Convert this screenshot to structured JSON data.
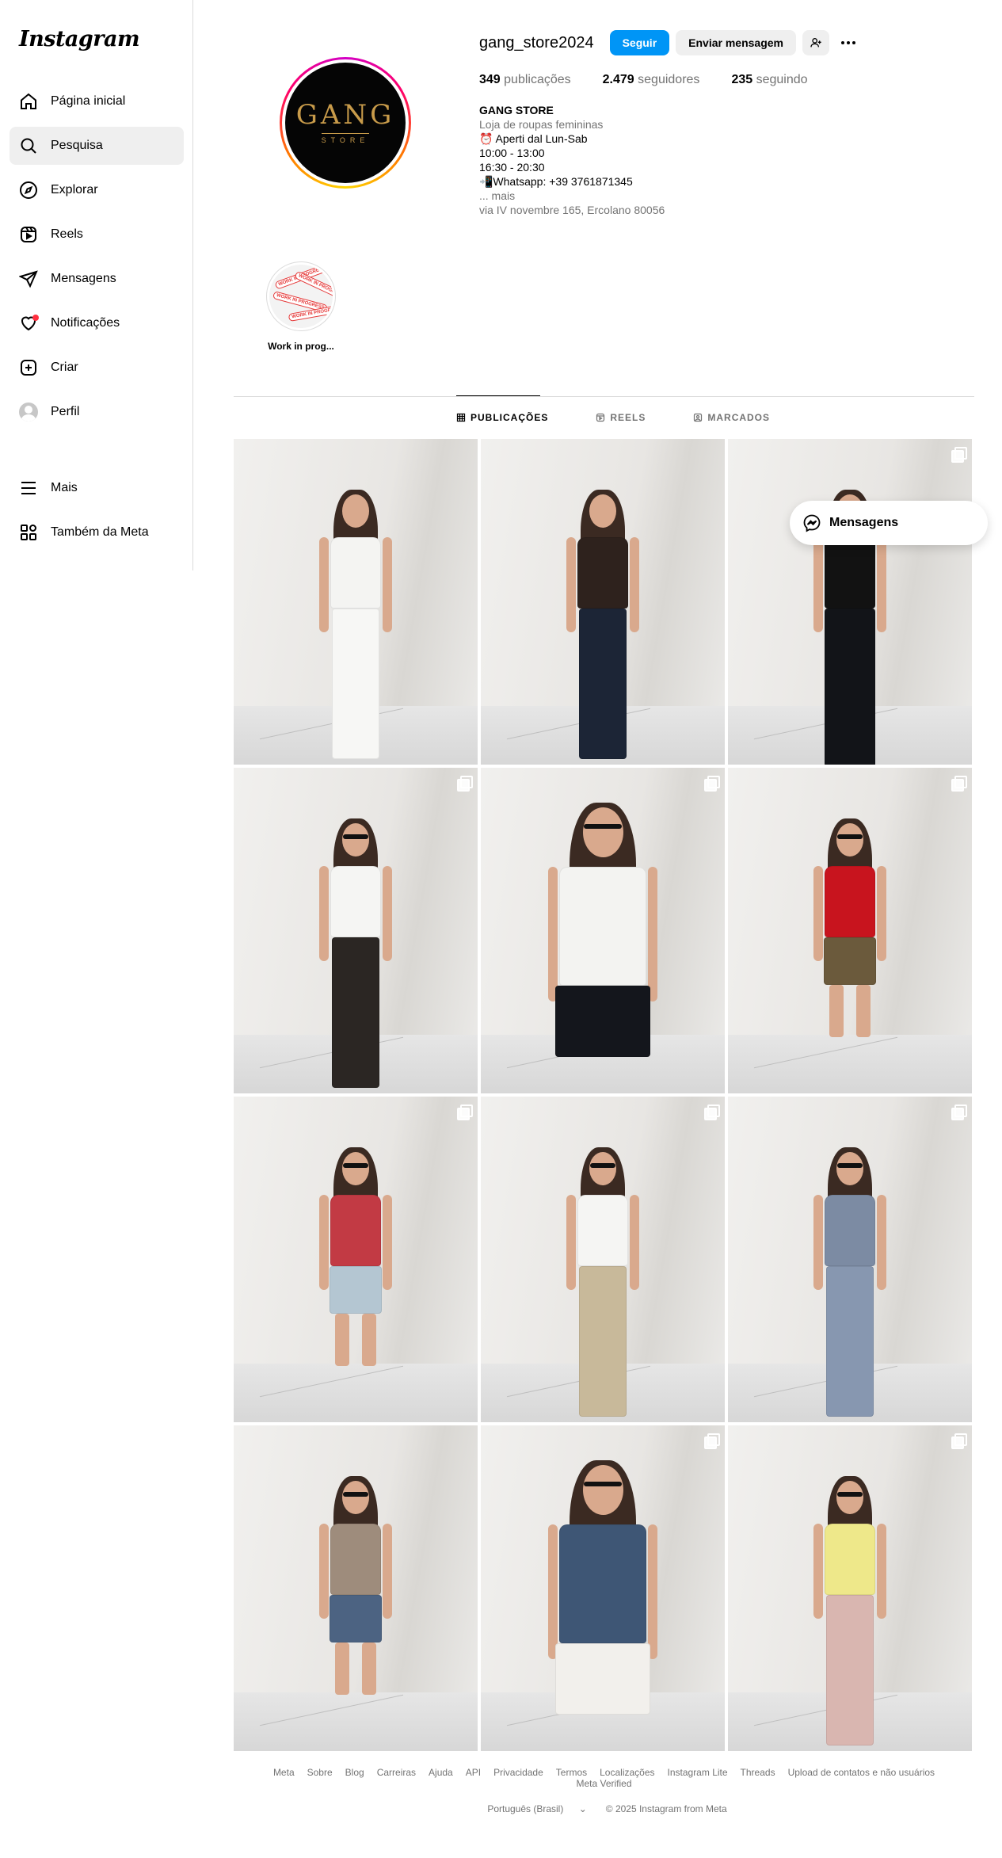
{
  "app": {
    "logo": "Instagram"
  },
  "sidebar": {
    "items": [
      {
        "label": "Página inicial",
        "icon": "home-icon"
      },
      {
        "label": "Pesquisa",
        "icon": "search-icon",
        "active": true
      },
      {
        "label": "Explorar",
        "icon": "compass-icon"
      },
      {
        "label": "Reels",
        "icon": "reels-icon"
      },
      {
        "label": "Mensagens",
        "icon": "paper-plane-icon"
      },
      {
        "label": "Notificações",
        "icon": "heart-icon",
        "has_dot": true
      },
      {
        "label": "Criar",
        "icon": "plus-square-icon"
      },
      {
        "label": "Perfil",
        "icon": "avatar"
      }
    ],
    "bottom": [
      {
        "label": "Mais",
        "icon": "menu-icon"
      },
      {
        "label": "Também da Meta",
        "icon": "grid-icon"
      }
    ]
  },
  "profile": {
    "username": "gang_store2024",
    "follow_label": "Seguir",
    "message_label": "Enviar mensagem",
    "logo_main": "GANG",
    "logo_sub": "STORE",
    "stats": {
      "posts_count": "349",
      "posts_label": "publicações",
      "followers_count": "2.479",
      "followers_label": "seguidores",
      "following_count": "235",
      "following_label": "seguindo"
    },
    "bio": {
      "name": "GANG STORE",
      "category": "Loja de roupas femininas",
      "line1": "⏰ Aperti dal Lun-Sab",
      "line2": "10:00 - 13:00",
      "line3": "16:30 - 20:30",
      "line4": "📲Whatsapp: +39 3761871345",
      "more": "... mais",
      "address": "via IV novembre 165, Ercolano 80056"
    }
  },
  "highlights": [
    {
      "label": "Work in prog...",
      "sticker": "WORK IN PROGRESS"
    }
  ],
  "tabs": [
    {
      "label": "PUBLICAÇÕES",
      "icon": "grid-icon",
      "active": true
    },
    {
      "label": "REELS",
      "icon": "reels-icon"
    },
    {
      "label": "MARCADOS",
      "icon": "tag-icon"
    }
  ],
  "posts": [
    {
      "multi": false,
      "top": "#f4f4f2",
      "bottom": "#f7f7f5",
      "shades": false,
      "pose": "standing"
    },
    {
      "multi": false,
      "top": "#2e221d",
      "bottom": "#1c2536",
      "shades": false,
      "pose": "standing"
    },
    {
      "multi": true,
      "top": "#121212",
      "bottom": "#121418",
      "shades": false,
      "pose": "long-skirt"
    },
    {
      "multi": true,
      "top": "#f5f5f3",
      "bottom": "#2b2623",
      "shades": true,
      "pose": "standing"
    },
    {
      "multi": true,
      "top": "#f3f3f1",
      "bottom": "#14161c",
      "shades": true,
      "pose": "close"
    },
    {
      "multi": true,
      "top": "#c8141e",
      "bottom": "#6b5a3c",
      "shades": true,
      "pose": "shorts"
    },
    {
      "multi": true,
      "top": "#c23a44",
      "bottom": "#b4c6d2",
      "shades": true,
      "pose": "shorts"
    },
    {
      "multi": true,
      "top": "#f5f5f3",
      "bottom": "#c8b99a",
      "shades": true,
      "pose": "standing"
    },
    {
      "multi": true,
      "top": "#7c8ba3",
      "bottom": "#8797b0",
      "shades": true,
      "pose": "standing"
    },
    {
      "multi": false,
      "top": "#9e8c7c",
      "bottom": "#4c6382",
      "shades": true,
      "pose": "shorts"
    },
    {
      "multi": true,
      "top": "#3e5675",
      "bottom": "#f2f0ec",
      "shades": true,
      "pose": "close"
    },
    {
      "multi": true,
      "top": "#eee88a",
      "bottom": "#d9b6b0",
      "shades": true,
      "pose": "standing"
    }
  ],
  "floating_messages": {
    "label": "Mensagens"
  },
  "footer": {
    "links": [
      "Meta",
      "Sobre",
      "Blog",
      "Carreiras",
      "Ajuda",
      "API",
      "Privacidade",
      "Termos",
      "Localizações",
      "Instagram Lite",
      "Threads",
      "Upload de contatos e não usuários",
      "Meta Verified"
    ],
    "language": "Português (Brasil)",
    "copyright": "© 2025 Instagram from Meta"
  }
}
